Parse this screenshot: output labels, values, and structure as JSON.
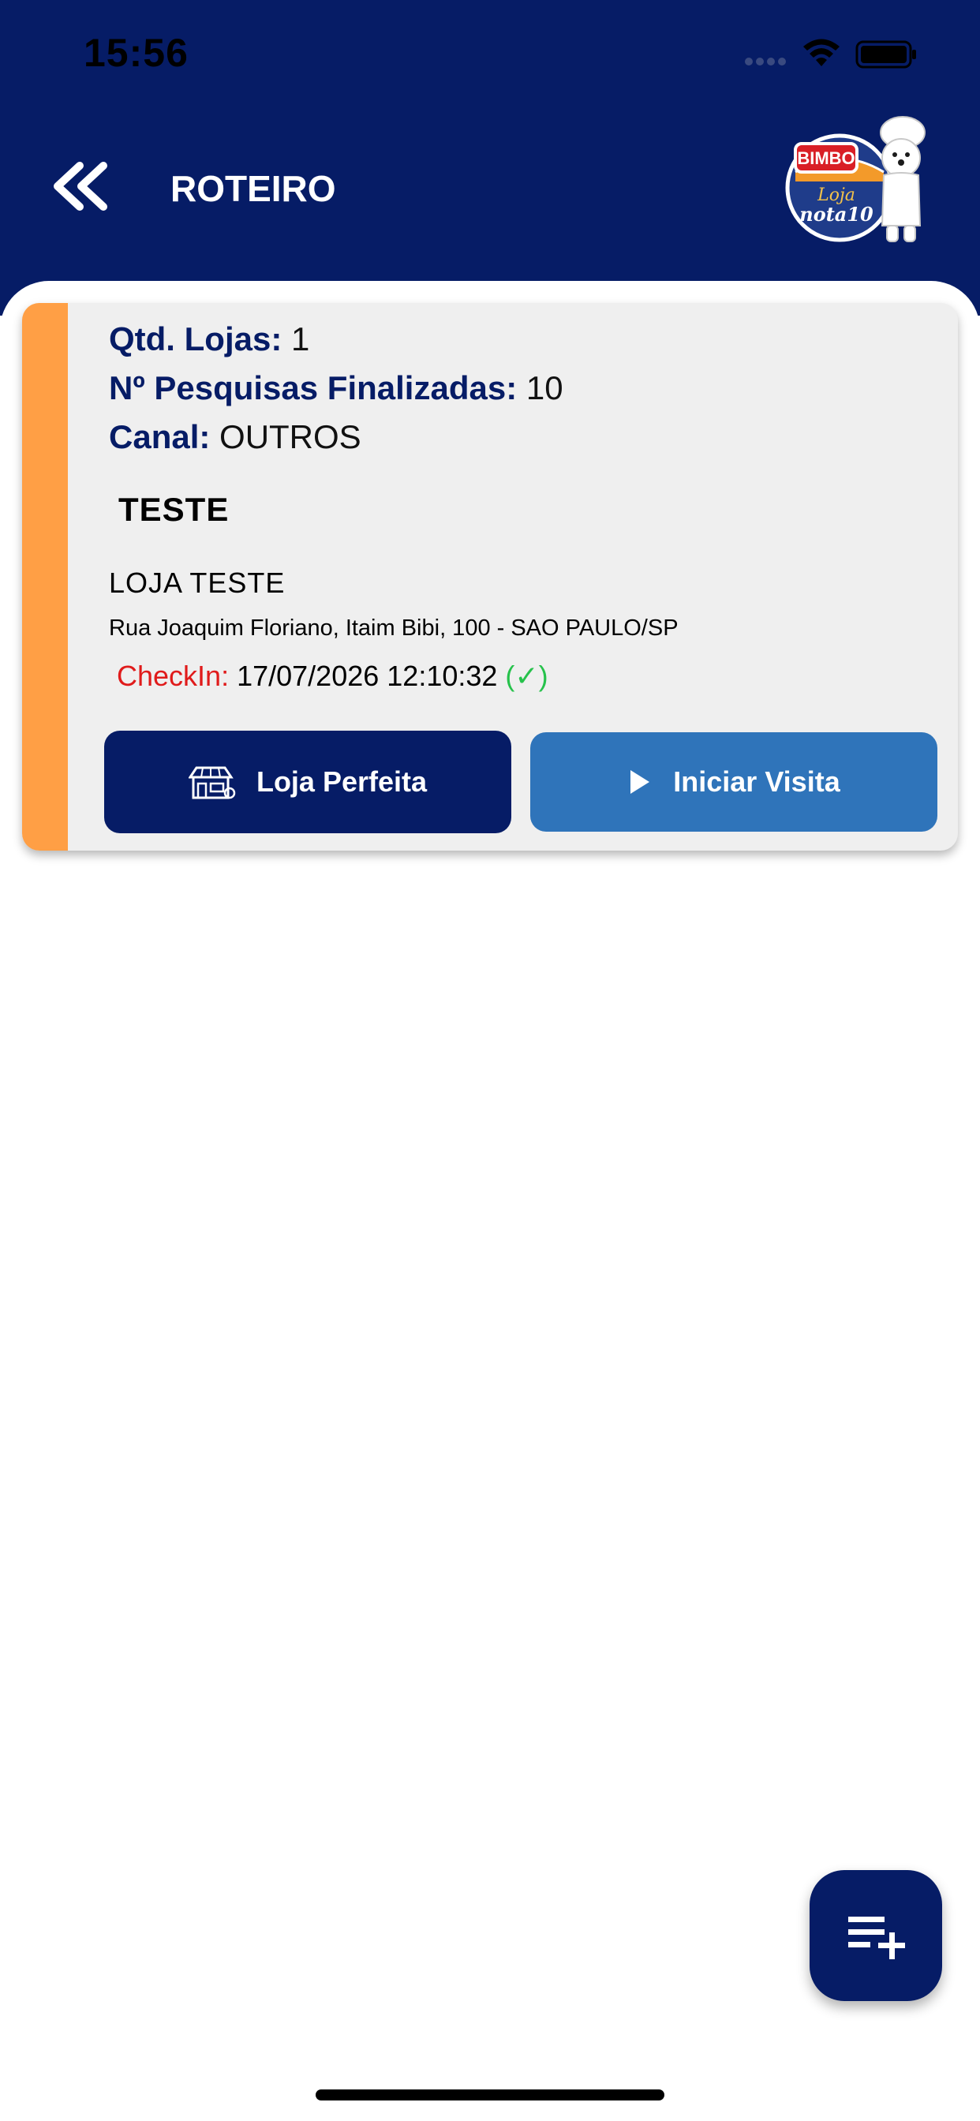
{
  "status_bar": {
    "time": "15:56"
  },
  "header": {
    "title": "ROTEIRO"
  },
  "logo": {
    "brand": "BIMBO",
    "tagline_top": "Loja",
    "tagline_bottom": "nota10"
  },
  "card": {
    "qtd_lojas_label": "Qtd. Lojas:",
    "qtd_lojas_value": "1",
    "pesquisas_label": "Nº Pesquisas Finalizadas:",
    "pesquisas_value": "10",
    "canal_label": "Canal:",
    "canal_value": "OUTROS",
    "group": "TESTE",
    "store_name": "LOJA TESTE",
    "address": "Rua Joaquim Floriano, Itaim Bibi, 100 - SAO PAULO/SP",
    "checkin_label": "CheckIn:",
    "checkin_value": "17/07/2026 12:10:32",
    "checkin_mark": "(✓)",
    "button_perfect": "Loja Perfeita",
    "button_visit": "Iniciar Visita"
  },
  "colors": {
    "header_bg": "#061c66",
    "accent_orange": "#ff9f45",
    "button_primary": "#061c66",
    "button_secondary": "#2f74ba",
    "checkin_label": "#e01b1b",
    "checkin_ok": "#27c24c"
  },
  "icons": {
    "back": "double-chevron-left-icon",
    "store": "store-icon",
    "play": "play-icon",
    "fab": "playlist-add-icon"
  }
}
